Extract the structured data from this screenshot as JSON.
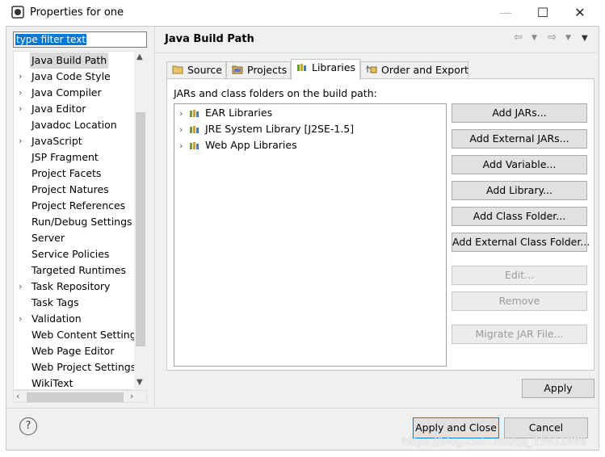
{
  "window": {
    "title": "Properties for one",
    "minimize": "—",
    "maximize": "☐",
    "close": "✕"
  },
  "filter": {
    "value": "type filter text"
  },
  "sidebar": {
    "items": [
      {
        "label": "Java Build Path",
        "expandable": false,
        "selected": true
      },
      {
        "label": "Java Code Style",
        "expandable": true
      },
      {
        "label": "Java Compiler",
        "expandable": true
      },
      {
        "label": "Java Editor",
        "expandable": true
      },
      {
        "label": "Javadoc Location",
        "expandable": false
      },
      {
        "label": "JavaScript",
        "expandable": true
      },
      {
        "label": "JSP Fragment",
        "expandable": false
      },
      {
        "label": "Project Facets",
        "expandable": false
      },
      {
        "label": "Project Natures",
        "expandable": false
      },
      {
        "label": "Project References",
        "expandable": false
      },
      {
        "label": "Run/Debug Settings",
        "expandable": false
      },
      {
        "label": "Server",
        "expandable": false
      },
      {
        "label": "Service Policies",
        "expandable": false
      },
      {
        "label": "Targeted Runtimes",
        "expandable": false
      },
      {
        "label": "Task Repository",
        "expandable": true
      },
      {
        "label": "Task Tags",
        "expandable": false
      },
      {
        "label": "Validation",
        "expandable": true
      },
      {
        "label": "Web Content Settings",
        "expandable": false
      },
      {
        "label": "Web Page Editor",
        "expandable": false
      },
      {
        "label": "Web Project Settings",
        "expandable": false
      },
      {
        "label": "WikiText",
        "expandable": false
      }
    ]
  },
  "page": {
    "title": "Java Build Path"
  },
  "tabs": [
    {
      "label": "Source",
      "icon": "source-folder-icon"
    },
    {
      "label": "Projects",
      "icon": "projects-folder-icon"
    },
    {
      "label": "Libraries",
      "icon": "libraries-icon",
      "active": true
    },
    {
      "label": "Order and Export",
      "icon": "order-export-icon"
    }
  ],
  "libraries": {
    "label": "JARs and class folders on the build path:",
    "items": [
      {
        "label": "EAR Libraries"
      },
      {
        "label": "JRE System Library [J2SE-1.5]"
      },
      {
        "label": "Web App Libraries"
      }
    ]
  },
  "buttons": {
    "add_jars": "Add JARs...",
    "add_external_jars": "Add External JARs...",
    "add_variable": "Add Variable...",
    "add_library": "Add Library...",
    "add_class_folder": "Add Class Folder...",
    "add_external_class_folder": "Add External Class Folder...",
    "edit": "Edit...",
    "remove": "Remove",
    "migrate_jar": "Migrate JAR File...",
    "apply": "Apply",
    "apply_close": "Apply and Close",
    "cancel": "Cancel"
  },
  "help": {
    "glyph": "?"
  },
  "watermark": "https://blog.csdn.net/qq_15611889"
}
